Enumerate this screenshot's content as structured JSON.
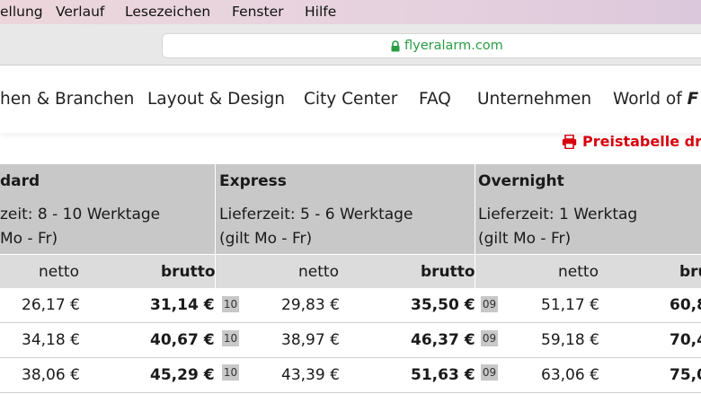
{
  "menu": [
    "ellung",
    "Verlauf",
    "Lesezeichen",
    "Fenster",
    "Hilfe"
  ],
  "address_bar": {
    "url": "flyeralarm.com",
    "lock_icon": "lock-icon"
  },
  "nav": {
    "items": [
      "hen & Branchen",
      "Layout & Design",
      "City Center",
      "FAQ",
      "Unternehmen",
      "World of"
    ],
    "logo_glyph": "F"
  },
  "print_link": {
    "label": "Preistabelle druc",
    "icon": "printer-icon",
    "color": "#d7000f"
  },
  "table": {
    "columns": [
      {
        "title": "dard",
        "line1": "zeit: 8 - 10 Werktage",
        "line2": "Mo - Fr)"
      },
      {
        "title": "Express",
        "line1": "Lieferzeit: 5 - 6 Werktage",
        "line2": "(gilt Mo - Fr)"
      },
      {
        "title": "Overnight",
        "line1": "Lieferzeit: 1 Werktag",
        "line2": "(gilt Mo - Fr)"
      }
    ],
    "sub_headers": {
      "netto": "netto",
      "brutto": "brutto",
      "brutto_cut": "bru"
    },
    "rows": [
      {
        "std_netto": "26,17 €",
        "std_brutto": "31,14 €",
        "exp_tag": "10",
        "exp_netto": "29,83 €",
        "exp_brutto": "35,50 €",
        "ovn_tag": "09",
        "ovn_netto": "51,17 €",
        "ovn_brutto": "60,8"
      },
      {
        "std_netto": "34,18 €",
        "std_brutto": "40,67 €",
        "exp_tag": "10",
        "exp_netto": "38,97 €",
        "exp_brutto": "46,37 €",
        "ovn_tag": "09",
        "ovn_netto": "59,18 €",
        "ovn_brutto": "70,4"
      },
      {
        "std_netto": "38,06 €",
        "std_brutto": "45,29 €",
        "exp_tag": "10",
        "exp_netto": "43,39 €",
        "exp_brutto": "51,63 €",
        "ovn_tag": "09",
        "ovn_netto": "63,06 €",
        "ovn_brutto": "75,0"
      }
    ]
  }
}
